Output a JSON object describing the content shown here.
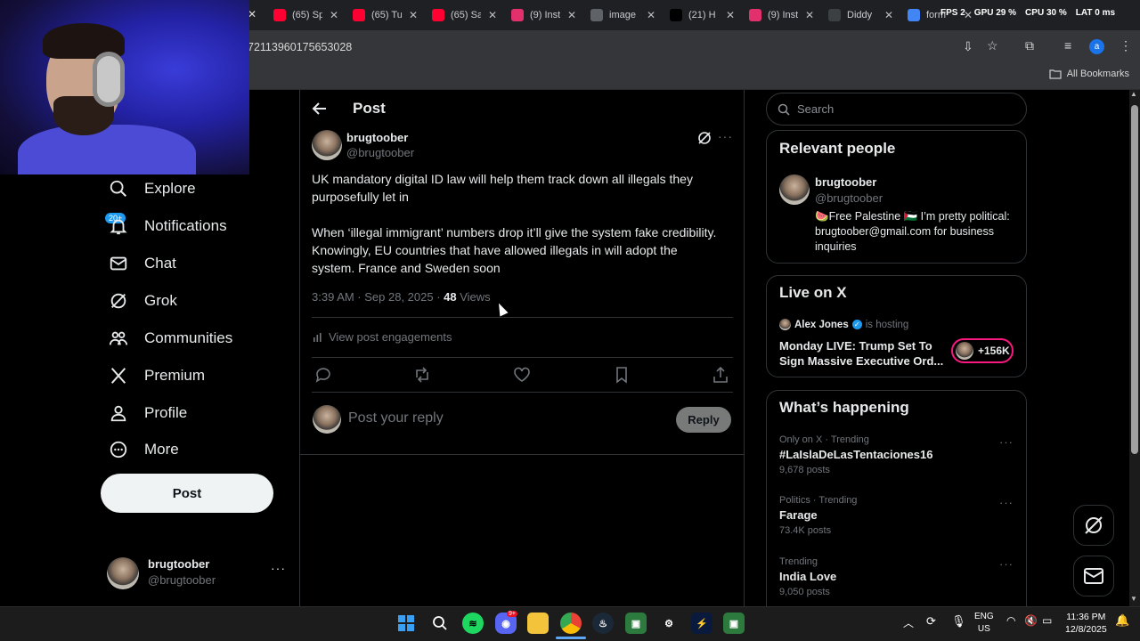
{
  "browser": {
    "tabs": [
      {
        "label": "(65) Sp",
        "icon": "youtube-icon",
        "color": "#ff0033"
      },
      {
        "label": "(65) Tu",
        "icon": "youtube-icon",
        "color": "#ff0033"
      },
      {
        "label": "(65) Sa",
        "icon": "youtube-icon",
        "color": "#ff0033"
      },
      {
        "label": "(9) Inst",
        "icon": "instagram-icon",
        "color": "#e1306c"
      },
      {
        "label": "image",
        "icon": "globe-icon",
        "color": "#5f6368"
      },
      {
        "label": "(21) H",
        "icon": "x-icon",
        "color": "#000000"
      },
      {
        "label": "(9) Inst",
        "icon": "instagram-icon",
        "color": "#e1306c"
      },
      {
        "label": "Diddy",
        "icon": "page-icon",
        "color": "#3c4043"
      },
      {
        "label": "form",
        "icon": "google-icon",
        "color": "#4285f4"
      }
    ],
    "url": "72113960175653028",
    "all_bookmarks": "All Bookmarks",
    "overlay": {
      "fps": "FPS",
      "fps_val": "2",
      "gpu": "GPU",
      "gpu_val": "29 %",
      "cpu": "CPU",
      "cpu_val": "30 %",
      "lat": "LAT",
      "lat_val": "0 ms"
    }
  },
  "nav": {
    "explore": "Explore",
    "notifications": "Notifications",
    "notif_badge": "20+",
    "chat": "Chat",
    "grok": "Grok",
    "communities": "Communities",
    "premium": "Premium",
    "profile": "Profile",
    "more": "More",
    "post_button": "Post",
    "account": {
      "name": "brugtoober",
      "handle": "@brugtoober"
    }
  },
  "post": {
    "header": "Post",
    "author": {
      "name": "brugtoober",
      "handle": "@brugtoober"
    },
    "text_1": "UK mandatory digital ID law will help them track down all illegals they purposefully let in",
    "text_2": "When ‘illegal immigrant’ numbers drop it’ll give the system fake credibility. Knowingly, EU countries that have allowed illegals in will adopt the system. France and Sweden soon",
    "timestamp": "3:39 AM · Sep 28, 2025 · ",
    "views_count": "48",
    "views_label": " Views",
    "engagements": "View post engagements",
    "reply_placeholder": "Post your reply",
    "reply_button": "Reply"
  },
  "sidebar": {
    "search_placeholder": "Search",
    "relevant": {
      "title": "Relevant people",
      "name": "brugtoober",
      "handle": "@brugtoober",
      "bio": "🍉Free Palestine 🇵🇸 I’m pretty political: brugtoober@gmail.com for business inquiries"
    },
    "live": {
      "title": "Live on X",
      "host": "Alex Jones",
      "hosting": "is hosting",
      "headline": "Monday LIVE: Trump Set To Sign Massive Executive Ord...",
      "listeners": "+156K"
    },
    "happening": {
      "title": "What’s happening",
      "trends": [
        {
          "context": "Only on X · Trending",
          "topic": "#LaIslaDeLasTentaciones16",
          "posts": "9,678 posts"
        },
        {
          "context": "Politics · Trending",
          "topic": "Farage",
          "posts": "73.4K posts"
        },
        {
          "context": "Trending",
          "topic": "India Love",
          "posts": "9,050 posts"
        }
      ]
    }
  },
  "taskbar": {
    "lang_1": "ENG",
    "lang_2": "US",
    "time": "11:36 PM",
    "date": "12/8/2025",
    "discord_badge": "9+"
  }
}
